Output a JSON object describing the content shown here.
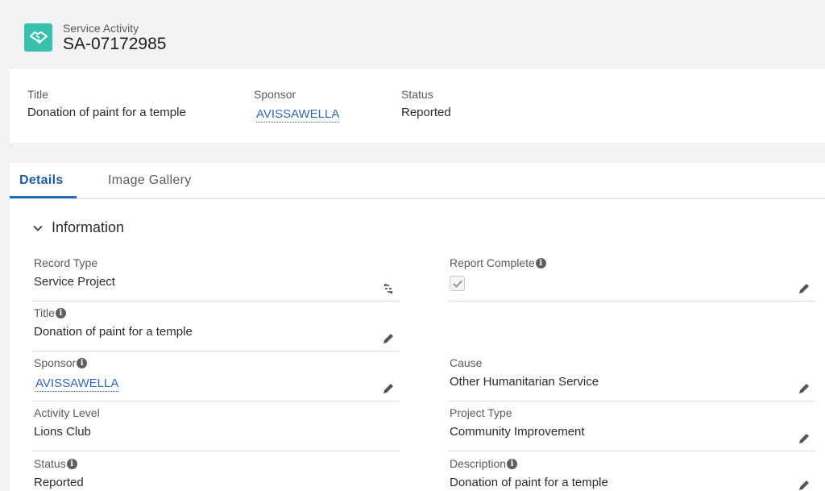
{
  "header": {
    "object_type": "Service Activity",
    "record_name": "SA-07172985",
    "icon": "handshake-icon",
    "icon_color": "#3bbfae"
  },
  "highlights": [
    {
      "label": "Title",
      "value": "Donation of paint for a temple"
    },
    {
      "label": "Sponsor",
      "value": "AVISSAWELLA"
    },
    {
      "label": "Status",
      "value": "Reported"
    }
  ],
  "tabs": [
    {
      "label": "Details",
      "active": true
    },
    {
      "label": "Image Gallery",
      "active": false
    }
  ],
  "section": {
    "title": "Information"
  },
  "fields": {
    "record_type": {
      "label": "Record Type",
      "value": "Service Project"
    },
    "report_complete": {
      "label": "Report Complete",
      "checked": true
    },
    "title": {
      "label": "Title",
      "value": "Donation of paint for a temple"
    },
    "sponsor": {
      "label": "Sponsor",
      "value": "AVISSAWELLA"
    },
    "cause": {
      "label": "Cause",
      "value": "Other Humanitarian Service"
    },
    "activity_level": {
      "label": "Activity Level",
      "value": "Lions Club"
    },
    "project_type": {
      "label": "Project Type",
      "value": "Community Improvement"
    },
    "status": {
      "label": "Status",
      "value": "Reported"
    },
    "description": {
      "label": "Description",
      "value": "Donation of paint for a temple"
    }
  },
  "colors": {
    "link": "#3567b0",
    "active_tab": "#1e6bb8"
  }
}
